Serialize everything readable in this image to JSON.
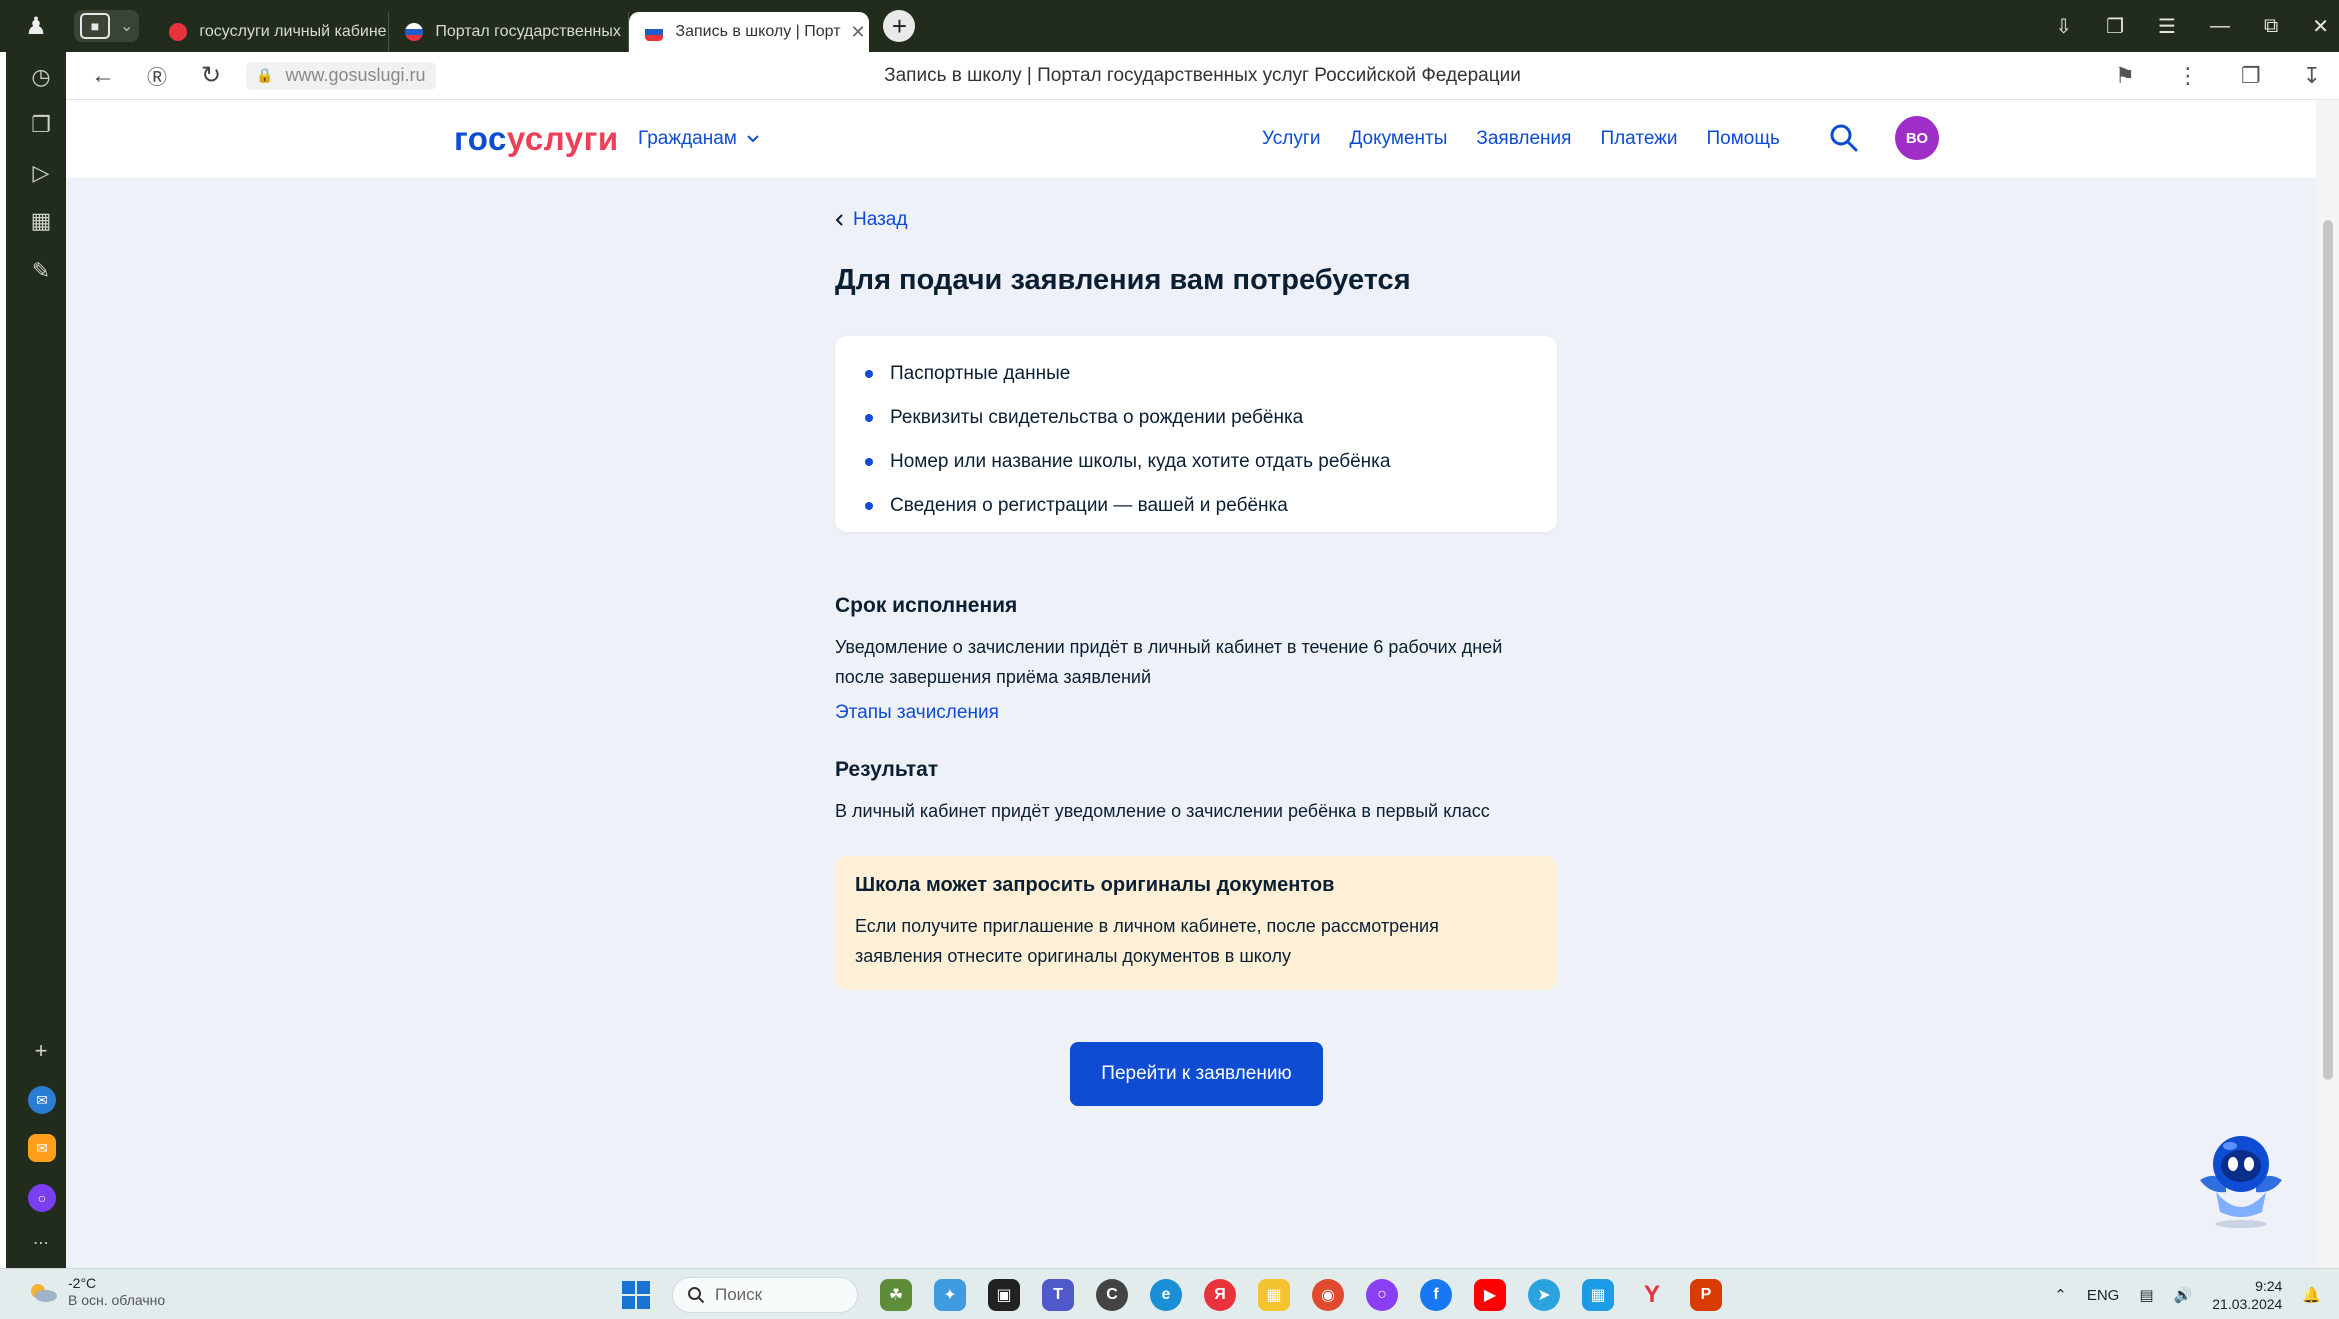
{
  "browser": {
    "tabs": [
      {
        "label": "госуслуги личный кабине",
        "favicon_color": "#e8333c",
        "active": false
      },
      {
        "label": "Портал государственных",
        "favicon_color": "#1f5ec9",
        "active": false
      },
      {
        "label": "Запись в школу | Порт",
        "favicon_color": "#1f5ec9",
        "active": true
      }
    ],
    "url": "www.gosuslugi.ru",
    "page_title": "Запись в школу | Портал государственных услуг Российской Федерации"
  },
  "header": {
    "logo_part1": "гос",
    "logo_part2": "услуги",
    "citizens_menu": "Гражданам",
    "nav": [
      "Услуги",
      "Документы",
      "Заявления",
      "Платежи",
      "Помощь"
    ],
    "avatar_initials": "ВО",
    "colors": {
      "brand_blue": "#0d4cd3",
      "brand_red": "#ee3f58",
      "avatar": "#9f2ec9"
    }
  },
  "main": {
    "back_label": "Назад",
    "title": "Для подачи заявления вам потребуется",
    "requirements": [
      "Паспортные данные",
      "Реквизиты свидетельства о рождении ребёнка",
      "Номер или название школы, куда хотите отдать ребёнка",
      "Сведения о регистрации — вашей и ребёнка"
    ],
    "term_heading": "Срок исполнения",
    "term_text_line1": "Уведомление о зачислении придёт в личный кабинет в течение 6 рабочих дней",
    "term_text_line2": "после завершения приёма заявлений",
    "stages_link": "Этапы зачисления",
    "result_heading": "Результат",
    "result_text": "В личный кабинет придёт уведомление о зачислении ребёнка в первый класс",
    "warning_title": "Школа может запросить оригиналы документов",
    "warning_text_line1": "Если получите приглашение в личном кабинете, после рассмотрения",
    "warning_text_line2": "заявления отнесите оригиналы документов в школу",
    "cta_label": "Перейти к заявлению"
  },
  "taskbar": {
    "weather_temp": "-2°C",
    "weather_desc": "В осн. облачно",
    "search_placeholder": "Поиск",
    "lang": "ENG",
    "time": "9:24",
    "date": "21.03.2024"
  }
}
